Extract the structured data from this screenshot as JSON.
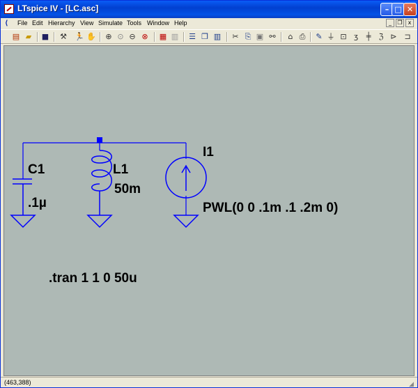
{
  "window": {
    "title": "LTspice IV - [LC.asc]",
    "controls": {
      "minimize": "–",
      "maximize": "□",
      "close": "✕"
    }
  },
  "menu": [
    "File",
    "Edit",
    "Hierarchy",
    "View",
    "Simulate",
    "Tools",
    "Window",
    "Help"
  ],
  "toolbar": {
    "icons": [
      "new-schematic-icon",
      "open-icon",
      "save-icon",
      "control-panel-icon",
      "run-icon",
      "pan-icon",
      "zoom-in-icon",
      "zoom-area-icon",
      "zoom-out-icon",
      "zoom-cancel-icon",
      "autorange-icon",
      "waveform-icon",
      "tile-horizontal-icon",
      "cascade-icon",
      "tile-vertical-icon",
      "cut-icon",
      "copy-icon",
      "paste-icon",
      "find-icon",
      "print-setup-icon",
      "print-icon",
      "wire-icon",
      "ground-icon",
      "label-icon",
      "resistor-icon",
      "capacitor-icon",
      "inductor-icon",
      "diode-icon",
      "component-icon"
    ]
  },
  "schematic": {
    "c1_name": "C1",
    "c1_value": ".1µ",
    "l1_name": "L1",
    "l1_value": "50m",
    "i1_name": "I1",
    "i1_value": "PWL(0 0 .1m .1 .2m 0)",
    "directive": ".tran 1 1 0 50u",
    "wire_color": "#0000ff"
  },
  "status": {
    "coords": "(463,388)"
  }
}
